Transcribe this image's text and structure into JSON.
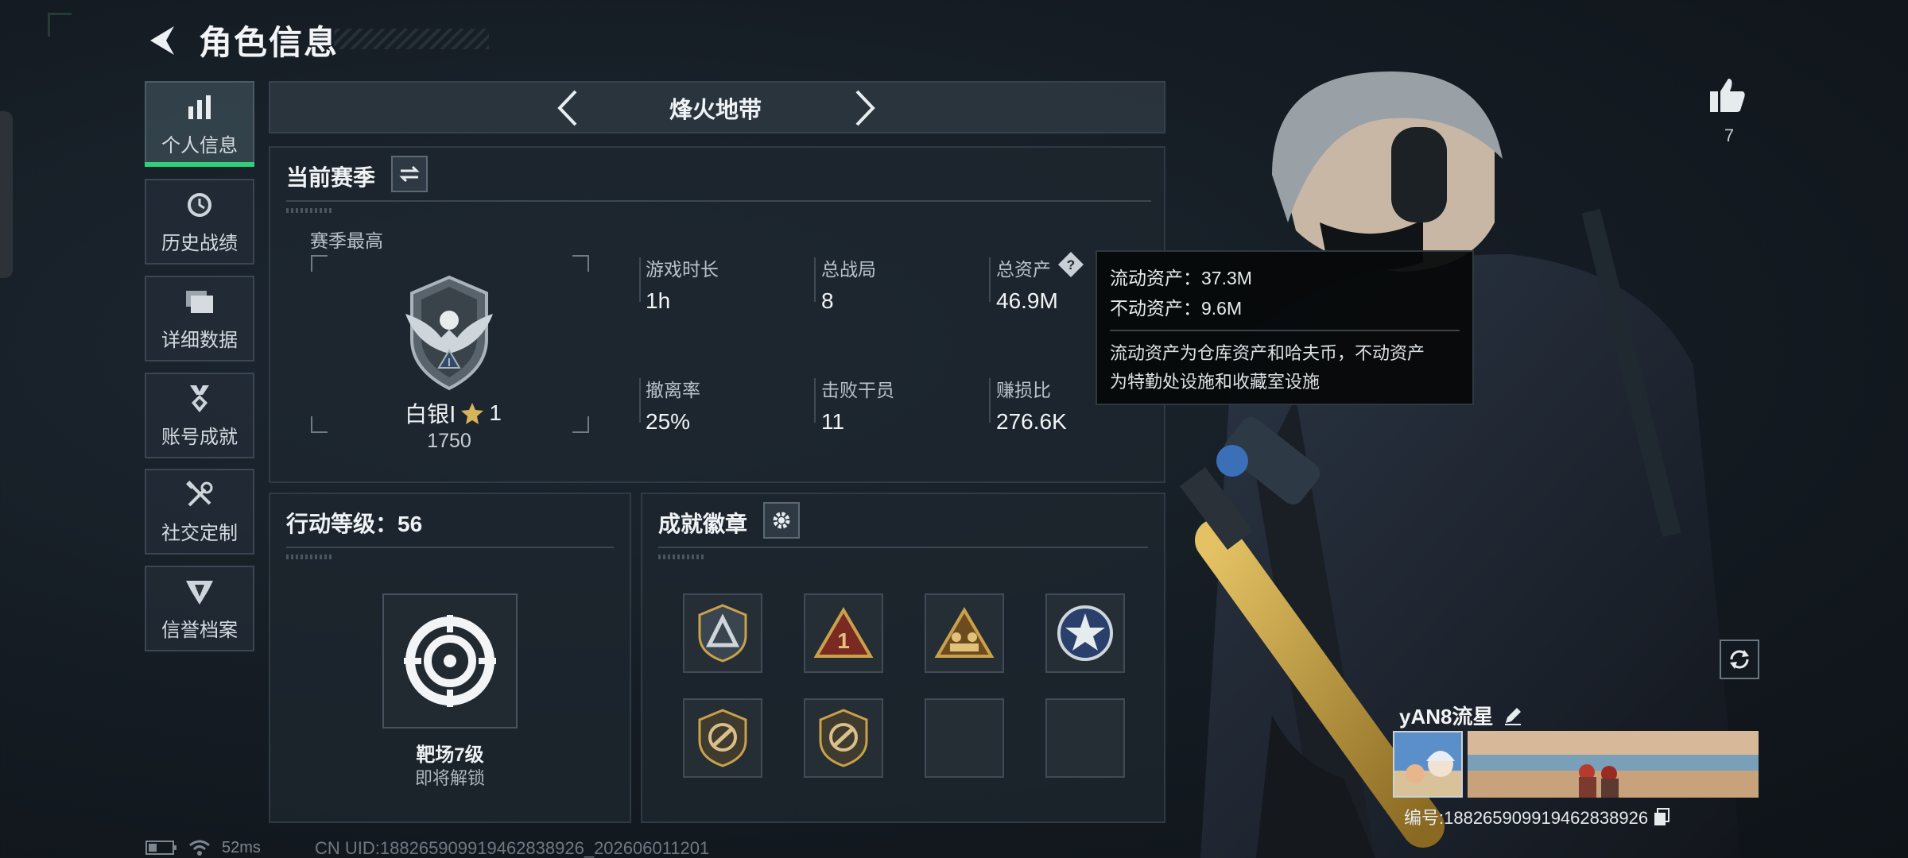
{
  "header": {
    "title": "角色信息"
  },
  "sidebar": {
    "items": [
      {
        "label": "个人信息",
        "icon": "bar-chart-icon",
        "active": true
      },
      {
        "label": "历史战绩",
        "icon": "clock-icon"
      },
      {
        "label": "详细数据",
        "icon": "folder-icon"
      },
      {
        "label": "账号成就",
        "icon": "medal-icon"
      },
      {
        "label": "社交定制",
        "icon": "tools-icon"
      },
      {
        "label": "信誉档案",
        "icon": "emblem-icon"
      }
    ]
  },
  "mode_selector": {
    "label": "烽火地带"
  },
  "season": {
    "title": "当前赛季",
    "best_label": "赛季最高",
    "rank_name": "白银Ⅰ",
    "rank_stars": "1",
    "rank_points": "1750",
    "stats": [
      {
        "label": "游戏时长",
        "value": "1h"
      },
      {
        "label": "总战局",
        "value": "8"
      },
      {
        "label": "总资产",
        "value": "46.9M"
      },
      {
        "label": "撤离率",
        "value": "25%"
      },
      {
        "label": "击败干员",
        "value": "11"
      },
      {
        "label": "赚损比",
        "value": "276.6K"
      }
    ]
  },
  "tooltip": {
    "liquid": "流动资产：37.3M",
    "fixed": "不动资产：9.6M",
    "desc_line1": "流动资产为仓库资产和哈夫币，不动资产",
    "desc_line2": "为特勤处设施和收藏室设施"
  },
  "action_level": {
    "title": "行动等级：56",
    "unlock_name": "靶场7级",
    "unlock_status": "即将解锁"
  },
  "achievements": {
    "title": "成就徽章"
  },
  "profile": {
    "like_count": "7",
    "nickname": "yAN8流星",
    "card_id": "编号:18826590991946283892​6"
  },
  "status_bar": {
    "ping": "52ms"
  },
  "footer": {
    "uid": "CN UID:18826590991946283892​6_202606011201"
  },
  "colors": {
    "accent_green": "#2fd07a",
    "rank_silver": "#a9b3bc",
    "badge_gold": "#c9a14a"
  }
}
